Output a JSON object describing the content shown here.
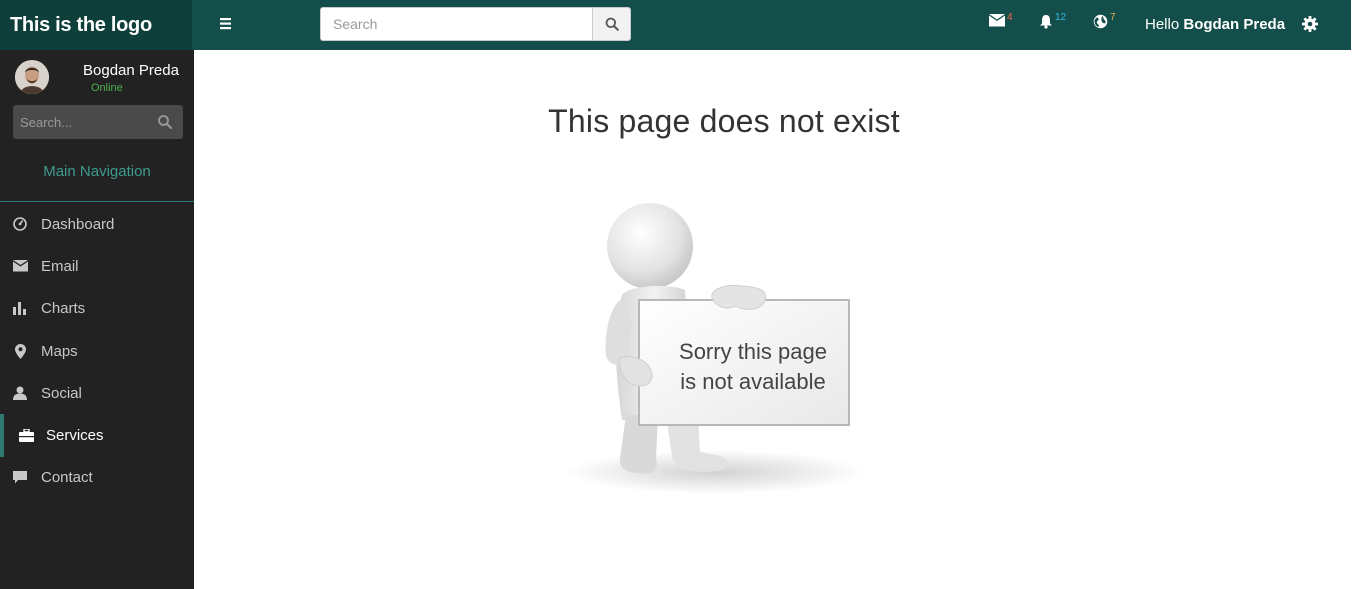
{
  "header": {
    "logo": "This is the logo",
    "search_placeholder": "Search",
    "mail_count": "4",
    "notification_count": "12",
    "globe_count": "7",
    "greeting_prefix": "Hello",
    "user_name": "Bogdan Preda"
  },
  "sidebar": {
    "user_name": "Bogdan Preda",
    "user_status": "Online",
    "search_placeholder": "Search...",
    "nav_header": "Main Navigation",
    "items": [
      {
        "label": "Dashboard",
        "icon": "dashboard-icon"
      },
      {
        "label": "Email",
        "icon": "envelope-icon"
      },
      {
        "label": "Charts",
        "icon": "bar-chart-icon"
      },
      {
        "label": "Maps",
        "icon": "map-marker-icon"
      },
      {
        "label": "Social",
        "icon": "user-icon"
      },
      {
        "label": "Services",
        "icon": "briefcase-icon",
        "active": true
      },
      {
        "label": "Contact",
        "icon": "comment-icon"
      }
    ]
  },
  "main": {
    "title": "This page does not exist",
    "sign_line1": "Sorry this page",
    "sign_line2": "is not available"
  },
  "colors": {
    "topbar": "#134e4a",
    "logo_bg": "#0f3f3b",
    "sidebar": "#222222",
    "accent": "#2f7a70",
    "online": "#4caf50"
  }
}
